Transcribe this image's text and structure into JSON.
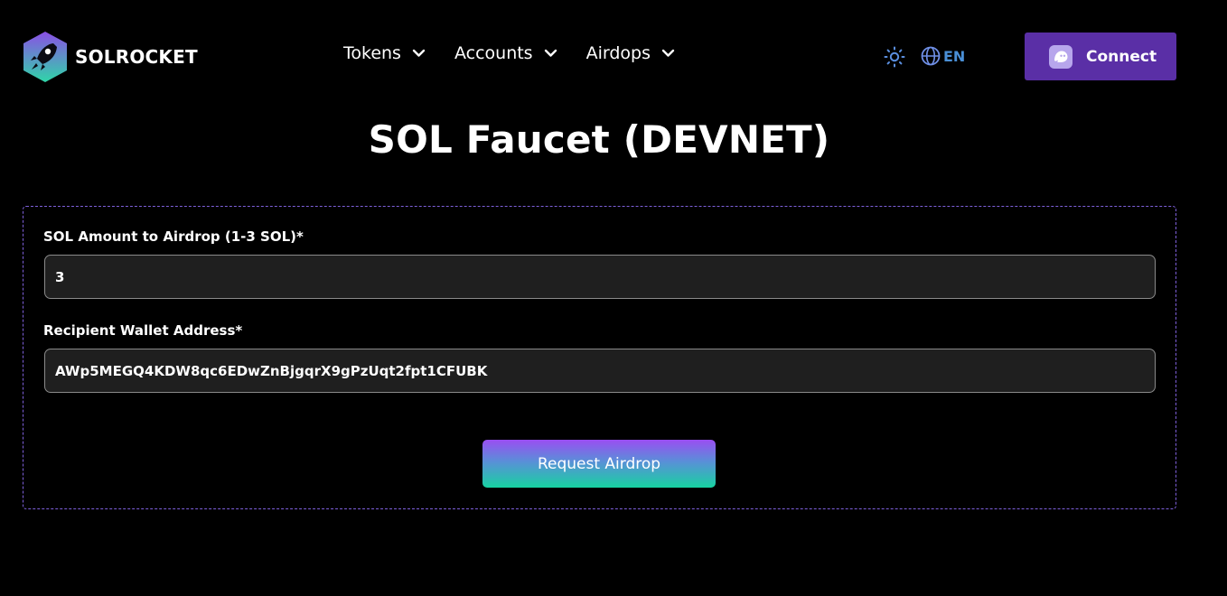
{
  "brand": {
    "name": "SOLROCKET",
    "logo_icon": "rocket-hexagon-logo"
  },
  "nav": {
    "items": [
      {
        "label": "Tokens",
        "icon": "chevron-down-icon"
      },
      {
        "label": "Accounts",
        "icon": "chevron-down-icon"
      },
      {
        "label": "Airdops",
        "icon": "chevron-down-icon"
      }
    ]
  },
  "header": {
    "theme_icon": "sun-icon",
    "language": {
      "icon": "globe-icon",
      "label": "EN"
    },
    "connect": {
      "label": "Connect",
      "icon": "ghost-wallet-icon"
    }
  },
  "page": {
    "title": "SOL Faucet (DEVNET)"
  },
  "form": {
    "amount": {
      "label": "SOL Amount to Airdrop (1-3 SOL)*",
      "value": "3"
    },
    "recipient": {
      "label": "Recipient Wallet Address*",
      "value": "AWp5MEGQ4KDW8qc6EDwZnBjgqrX9gPzUqt2fpt1CFUBK"
    },
    "submit_label": "Request Airdrop"
  },
  "colors": {
    "background": "#000000",
    "accent_purple": "#5a2fa6",
    "dashed_border": "#7d5fd9",
    "language_blue": "#4a8fd6",
    "gradient_top": "#9a4ef2",
    "gradient_bottom": "#17d3a1"
  }
}
